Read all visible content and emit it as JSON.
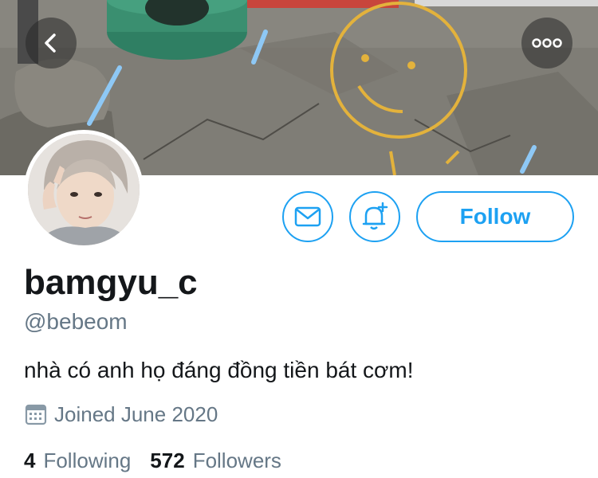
{
  "profile": {
    "display_name": "bamgyu_c",
    "handle": "@bebeom",
    "bio": "nhà có anh họ đáng đồng tiền bát cơm!",
    "joined": "Joined June 2020"
  },
  "actions": {
    "follow_label": "Follow",
    "mail_icon": "mail-icon",
    "notify_icon": "bell-plus-icon",
    "back_icon": "back-arrow-icon",
    "more_icon": "more-icon"
  },
  "stats": {
    "following_count": "4",
    "following_label": "Following",
    "followers_count": "572",
    "followers_label": "Followers"
  },
  "colors": {
    "accent": "#1da1f2",
    "secondary_text": "#657786",
    "primary_text": "#14171a"
  }
}
